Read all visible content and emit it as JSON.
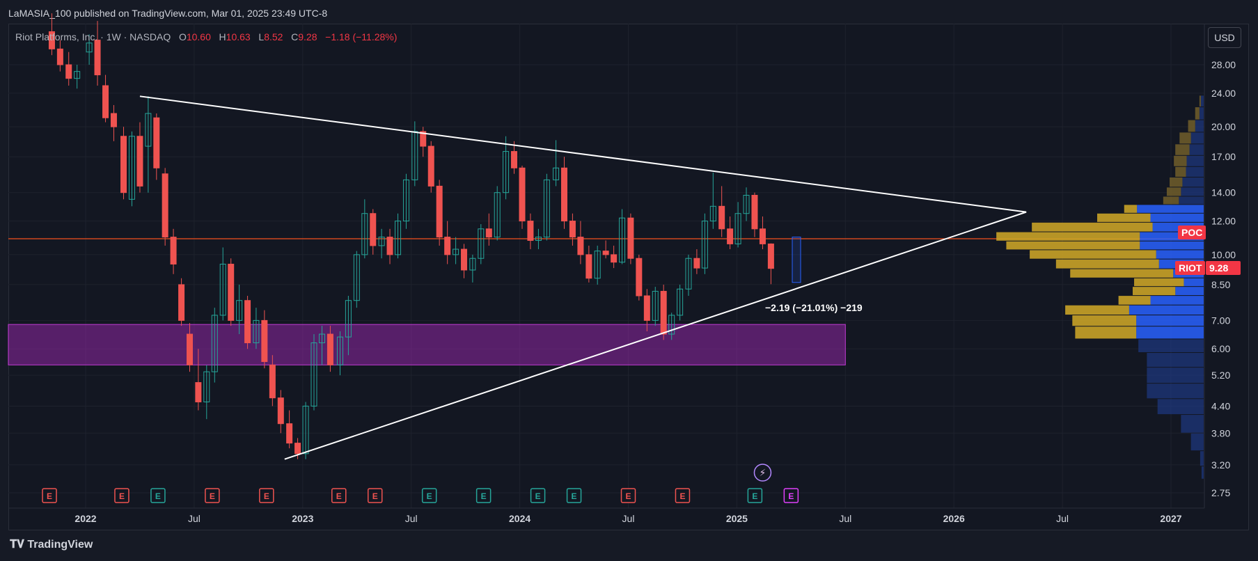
{
  "header": {
    "published": "LaMASIA_100 published on TradingView.com, Mar 01, 2025 23:49 UTC-8"
  },
  "symbol": {
    "title": "Riot Platforms, Inc. · 1W · NASDAQ",
    "o_label": "O",
    "o": "10.60",
    "h_label": "H",
    "h": "10.63",
    "l_label": "L",
    "l": "8.52",
    "c_label": "C",
    "c": "9.28",
    "change": "−1.18 (−11.28%)"
  },
  "currency": "USD",
  "badges": {
    "poc": "POC",
    "ticker": "RIOT",
    "price": "9.28"
  },
  "measure_label": "−2.19 (−21.01%) −219",
  "footer": {
    "logo_text": "TradingView"
  },
  "chart_data": {
    "type": "candlestick",
    "title": "Riot Platforms, Inc. · 1W · NASDAQ",
    "ylim": [
      2.6,
      36
    ],
    "y_scale": "log",
    "y_ticks": [
      "28.00",
      "24.00",
      "20.00",
      "17.00",
      "14.00",
      "12.00",
      "10.00",
      "8.50",
      "7.00",
      "6.00",
      "5.20",
      "4.40",
      "3.80",
      "3.20",
      "2.75"
    ],
    "x_ticks": [
      "2022",
      "Jul",
      "2023",
      "Jul",
      "2024",
      "Jul",
      "2025",
      "Jul",
      "2026",
      "Jul",
      "2027"
    ],
    "x_tick_dates": [
      "2022-01",
      "2022-07",
      "2023-01",
      "2023-07",
      "2024-01",
      "2024-07",
      "2025-01",
      "2025-07",
      "2026-01",
      "2026-07",
      "2027-01"
    ],
    "grid": true,
    "last_close": 9.28,
    "poc_level": 10.9,
    "purple_zone": {
      "from_date": "2021-12",
      "to_date": "2025-07",
      "low": 5.5,
      "high": 6.85
    },
    "trendlines": [
      {
        "label": "upper resistance",
        "from": [
          "2022-04",
          23.6
        ],
        "to": [
          "2026-05",
          12.6
        ]
      },
      {
        "label": "lower support",
        "from": [
          "2022-12",
          3.3
        ],
        "to": [
          "2026-05",
          12.6
        ]
      }
    ],
    "earnings_markers": [
      {
        "date": "2021-11",
        "type": "miss"
      },
      {
        "date": "2022-03",
        "type": "miss"
      },
      {
        "date": "2022-05",
        "type": "beat"
      },
      {
        "date": "2022-08",
        "type": "miss"
      },
      {
        "date": "2022-11",
        "type": "miss"
      },
      {
        "date": "2023-03",
        "type": "miss"
      },
      {
        "date": "2023-05",
        "type": "miss"
      },
      {
        "date": "2023-08",
        "type": "beat"
      },
      {
        "date": "2023-11",
        "type": "beat"
      },
      {
        "date": "2024-02",
        "type": "beat"
      },
      {
        "date": "2024-04",
        "type": "beat"
      },
      {
        "date": "2024-07",
        "type": "miss"
      },
      {
        "date": "2024-10",
        "type": "miss"
      },
      {
        "date": "2025-02",
        "type": "beat"
      },
      {
        "date": "2025-04",
        "type": "upcoming"
      }
    ],
    "volume_profile": [
      {
        "price": 23.0,
        "up": 0.2,
        "down": 0.4
      },
      {
        "price": 21.5,
        "up": 0.6,
        "down": 0.6
      },
      {
        "price": 20.0,
        "up": 1.0,
        "down": 1.2
      },
      {
        "price": 18.8,
        "up": 1.6,
        "down": 1.8
      },
      {
        "price": 17.6,
        "up": 2.0,
        "down": 2.0
      },
      {
        "price": 16.6,
        "up": 1.8,
        "down": 2.4
      },
      {
        "price": 15.6,
        "up": 1.5,
        "down": 2.5
      },
      {
        "price": 14.8,
        "up": 1.8,
        "down": 3.0
      },
      {
        "price": 14.0,
        "up": 2.0,
        "down": 3.2
      },
      {
        "price": 13.4,
        "up": 2.2,
        "down": 3.5
      },
      {
        "price": 12.8,
        "up": 1.8,
        "down": 9.4
      },
      {
        "price": 12.2,
        "up": 7.5,
        "down": 7.5
      },
      {
        "price": 11.6,
        "up": 17.0,
        "down": 7.2
      },
      {
        "price": 11.0,
        "up": 20.2,
        "down": 9.0
      },
      {
        "price": 10.5,
        "up": 18.8,
        "down": 9.0
      },
      {
        "price": 10.0,
        "up": 17.8,
        "down": 6.7
      },
      {
        "price": 9.5,
        "up": 14.5,
        "down": 6.3
      },
      {
        "price": 9.0,
        "up": 14.5,
        "down": 4.3
      },
      {
        "price": 8.6,
        "up": 7.0,
        "down": 2.8
      },
      {
        "price": 8.2,
        "up": 6.0,
        "down": 4.0
      },
      {
        "price": 7.8,
        "up": 4.5,
        "down": 7.5
      },
      {
        "price": 7.4,
        "up": 9.0,
        "down": 10.5
      },
      {
        "price": 7.0,
        "up": 9.0,
        "down": 9.5
      },
      {
        "price": 6.55,
        "up": 8.6,
        "down": 9.5
      },
      {
        "price": 6.1,
        "up": 0.0,
        "down": 9.2
      },
      {
        "price": 5.65,
        "up": 0.0,
        "down": 8.0
      },
      {
        "price": 5.2,
        "up": 0.0,
        "down": 8.0
      },
      {
        "price": 4.75,
        "up": 0.0,
        "down": 8.0
      },
      {
        "price": 4.4,
        "up": 0.0,
        "down": 6.5
      },
      {
        "price": 4.0,
        "up": 0.0,
        "down": 3.2
      },
      {
        "price": 3.6,
        "up": 0.0,
        "down": 1.8
      },
      {
        "price": 3.3,
        "up": 0.0,
        "down": 0.5
      },
      {
        "price": 3.05,
        "up": 0.0,
        "down": 0.3
      }
    ],
    "candles": [
      {
        "t": "2021-11-05",
        "o": 33.5,
        "h": 37.0,
        "l": 29.5,
        "c": 30.5
      },
      {
        "t": "2021-11-19",
        "o": 30.5,
        "h": 32.0,
        "l": 27.0,
        "c": 28.0
      },
      {
        "t": "2021-12-03",
        "o": 28.0,
        "h": 30.0,
        "l": 25.0,
        "c": 26.0
      },
      {
        "t": "2021-12-17",
        "o": 26.0,
        "h": 28.0,
        "l": 24.6,
        "c": 27.0
      },
      {
        "t": "2022-01-07",
        "o": 30.0,
        "h": 33.0,
        "l": 28.0,
        "c": 31.5
      },
      {
        "t": "2022-01-21",
        "o": 32.0,
        "h": 35.5,
        "l": 25.0,
        "c": 26.5
      },
      {
        "t": "2022-02-04",
        "o": 25.0,
        "h": 26.5,
        "l": 20.5,
        "c": 21.0
      },
      {
        "t": "2022-02-18",
        "o": 21.5,
        "h": 22.5,
        "l": 18.5,
        "c": 20.0
      },
      {
        "t": "2022-03-04",
        "o": 19.0,
        "h": 20.0,
        "l": 13.5,
        "c": 14.0
      },
      {
        "t": "2022-03-18",
        "o": 13.5,
        "h": 19.5,
        "l": 13.0,
        "c": 19.0
      },
      {
        "t": "2022-04-01",
        "o": 19.0,
        "h": 20.5,
        "l": 14.0,
        "c": 14.5
      },
      {
        "t": "2022-04-15",
        "o": 18.0,
        "h": 23.6,
        "l": 14.0,
        "c": 21.5
      },
      {
        "t": "2022-04-29",
        "o": 21.0,
        "h": 21.5,
        "l": 15.0,
        "c": 16.0
      },
      {
        "t": "2022-05-13",
        "o": 15.5,
        "h": 16.0,
        "l": 10.5,
        "c": 11.0
      },
      {
        "t": "2022-05-27",
        "o": 11.0,
        "h": 11.5,
        "l": 9.0,
        "c": 9.5
      },
      {
        "t": "2022-06-10",
        "o": 8.5,
        "h": 8.8,
        "l": 6.8,
        "c": 7.0
      },
      {
        "t": "2022-06-24",
        "o": 6.5,
        "h": 6.9,
        "l": 5.3,
        "c": 5.5
      },
      {
        "t": "2022-07-08",
        "o": 5.0,
        "h": 6.0,
        "l": 4.3,
        "c": 4.5
      },
      {
        "t": "2022-07-22",
        "o": 4.5,
        "h": 5.5,
        "l": 4.1,
        "c": 5.3
      },
      {
        "t": "2022-08-05",
        "o": 5.3,
        "h": 7.5,
        "l": 5.0,
        "c": 7.2
      },
      {
        "t": "2022-08-19",
        "o": 7.2,
        "h": 10.4,
        "l": 7.0,
        "c": 9.5
      },
      {
        "t": "2022-09-02",
        "o": 9.5,
        "h": 9.8,
        "l": 6.8,
        "c": 7.0
      },
      {
        "t": "2022-09-16",
        "o": 7.0,
        "h": 8.5,
        "l": 6.5,
        "c": 7.8
      },
      {
        "t": "2022-09-30",
        "o": 7.8,
        "h": 8.0,
        "l": 6.0,
        "c": 6.2
      },
      {
        "t": "2022-10-14",
        "o": 6.2,
        "h": 7.5,
        "l": 6.0,
        "c": 7.0
      },
      {
        "t": "2022-10-28",
        "o": 7.0,
        "h": 7.4,
        "l": 5.4,
        "c": 5.6
      },
      {
        "t": "2022-11-11",
        "o": 5.5,
        "h": 5.8,
        "l": 4.4,
        "c": 4.6
      },
      {
        "t": "2022-11-25",
        "o": 4.6,
        "h": 4.8,
        "l": 3.8,
        "c": 4.0
      },
      {
        "t": "2022-12-09",
        "o": 4.0,
        "h": 4.3,
        "l": 3.5,
        "c": 3.6
      },
      {
        "t": "2022-12-23",
        "o": 3.6,
        "h": 3.7,
        "l": 3.3,
        "c": 3.4
      },
      {
        "t": "2023-01-06",
        "o": 3.4,
        "h": 4.5,
        "l": 3.3,
        "c": 4.4
      },
      {
        "t": "2023-01-20",
        "o": 4.4,
        "h": 6.5,
        "l": 4.3,
        "c": 6.2
      },
      {
        "t": "2023-02-03",
        "o": 6.2,
        "h": 6.8,
        "l": 5.5,
        "c": 6.5
      },
      {
        "t": "2023-02-17",
        "o": 6.5,
        "h": 6.8,
        "l": 5.3,
        "c": 5.5
      },
      {
        "t": "2023-03-03",
        "o": 5.5,
        "h": 6.6,
        "l": 5.2,
        "c": 6.4
      },
      {
        "t": "2023-03-17",
        "o": 6.4,
        "h": 8.0,
        "l": 5.8,
        "c": 7.8
      },
      {
        "t": "2023-03-31",
        "o": 7.8,
        "h": 10.2,
        "l": 7.5,
        "c": 10.0
      },
      {
        "t": "2023-04-14",
        "o": 10.0,
        "h": 13.5,
        "l": 9.8,
        "c": 12.5
      },
      {
        "t": "2023-04-28",
        "o": 12.5,
        "h": 12.8,
        "l": 10.0,
        "c": 10.5
      },
      {
        "t": "2023-05-12",
        "o": 10.5,
        "h": 11.5,
        "l": 9.8,
        "c": 11.0
      },
      {
        "t": "2023-05-26",
        "o": 11.0,
        "h": 11.5,
        "l": 9.5,
        "c": 10.0
      },
      {
        "t": "2023-06-09",
        "o": 10.0,
        "h": 12.5,
        "l": 9.8,
        "c": 12.0
      },
      {
        "t": "2023-06-23",
        "o": 12.0,
        "h": 15.5,
        "l": 11.5,
        "c": 15.0
      },
      {
        "t": "2023-07-07",
        "o": 15.0,
        "h": 20.6,
        "l": 14.5,
        "c": 19.5
      },
      {
        "t": "2023-07-21",
        "o": 19.5,
        "h": 20.0,
        "l": 17.0,
        "c": 18.0
      },
      {
        "t": "2023-08-04",
        "o": 18.0,
        "h": 18.5,
        "l": 14.0,
        "c": 14.5
      },
      {
        "t": "2023-08-18",
        "o": 14.5,
        "h": 15.0,
        "l": 10.5,
        "c": 11.0
      },
      {
        "t": "2023-09-01",
        "o": 11.0,
        "h": 12.0,
        "l": 9.5,
        "c": 10.0
      },
      {
        "t": "2023-09-15",
        "o": 10.0,
        "h": 11.0,
        "l": 9.5,
        "c": 10.3
      },
      {
        "t": "2023-09-29",
        "o": 10.3,
        "h": 10.6,
        "l": 8.8,
        "c": 9.2
      },
      {
        "t": "2023-10-13",
        "o": 9.2,
        "h": 10.0,
        "l": 8.6,
        "c": 9.8
      },
      {
        "t": "2023-10-27",
        "o": 9.8,
        "h": 11.8,
        "l": 9.5,
        "c": 11.5
      },
      {
        "t": "2023-11-10",
        "o": 11.5,
        "h": 12.5,
        "l": 10.5,
        "c": 11.0
      },
      {
        "t": "2023-11-24",
        "o": 11.0,
        "h": 14.5,
        "l": 10.8,
        "c": 14.0
      },
      {
        "t": "2023-12-08",
        "o": 14.0,
        "h": 19.0,
        "l": 13.5,
        "c": 17.5
      },
      {
        "t": "2023-12-22",
        "o": 17.5,
        "h": 18.5,
        "l": 15.5,
        "c": 16.0
      },
      {
        "t": "2024-01-05",
        "o": 16.0,
        "h": 16.2,
        "l": 11.5,
        "c": 12.0
      },
      {
        "t": "2024-01-19",
        "o": 12.0,
        "h": 12.5,
        "l": 10.3,
        "c": 10.8
      },
      {
        "t": "2024-02-02",
        "o": 10.8,
        "h": 11.5,
        "l": 10.3,
        "c": 11.0
      },
      {
        "t": "2024-02-16",
        "o": 11.0,
        "h": 15.5,
        "l": 10.8,
        "c": 15.0
      },
      {
        "t": "2024-03-01",
        "o": 15.0,
        "h": 18.6,
        "l": 14.5,
        "c": 16.0
      },
      {
        "t": "2024-03-15",
        "o": 16.0,
        "h": 17.0,
        "l": 11.5,
        "c": 12.0
      },
      {
        "t": "2024-03-29",
        "o": 12.0,
        "h": 12.5,
        "l": 10.5,
        "c": 11.0
      },
      {
        "t": "2024-04-12",
        "o": 11.0,
        "h": 12.0,
        "l": 9.5,
        "c": 10.0
      },
      {
        "t": "2024-04-26",
        "o": 10.0,
        "h": 10.5,
        "l": 8.6,
        "c": 8.8
      },
      {
        "t": "2024-05-10",
        "o": 8.8,
        "h": 10.5,
        "l": 8.5,
        "c": 10.2
      },
      {
        "t": "2024-05-24",
        "o": 10.2,
        "h": 10.8,
        "l": 9.8,
        "c": 10.0
      },
      {
        "t": "2024-06-07",
        "o": 10.0,
        "h": 10.5,
        "l": 9.3,
        "c": 9.6
      },
      {
        "t": "2024-06-21",
        "o": 9.6,
        "h": 12.8,
        "l": 9.5,
        "c": 12.2
      },
      {
        "t": "2024-07-05",
        "o": 12.2,
        "h": 12.5,
        "l": 9.5,
        "c": 9.8
      },
      {
        "t": "2024-07-19",
        "o": 9.8,
        "h": 10.0,
        "l": 7.8,
        "c": 8.0
      },
      {
        "t": "2024-08-02",
        "o": 8.0,
        "h": 8.3,
        "l": 6.6,
        "c": 7.0
      },
      {
        "t": "2024-08-16",
        "o": 7.0,
        "h": 8.4,
        "l": 6.8,
        "c": 8.2
      },
      {
        "t": "2024-08-30",
        "o": 8.2,
        "h": 8.5,
        "l": 6.3,
        "c": 6.5
      },
      {
        "t": "2024-09-13",
        "o": 6.5,
        "h": 7.3,
        "l": 6.3,
        "c": 7.2
      },
      {
        "t": "2024-09-27",
        "o": 7.2,
        "h": 8.5,
        "l": 7.0,
        "c": 8.3
      },
      {
        "t": "2024-10-11",
        "o": 8.3,
        "h": 10.0,
        "l": 8.0,
        "c": 9.8
      },
      {
        "t": "2024-10-25",
        "o": 9.8,
        "h": 10.3,
        "l": 9.0,
        "c": 9.3
      },
      {
        "t": "2024-11-08",
        "o": 9.3,
        "h": 12.5,
        "l": 9.0,
        "c": 12.0
      },
      {
        "t": "2024-11-22",
        "o": 12.0,
        "h": 15.6,
        "l": 11.5,
        "c": 13.0
      },
      {
        "t": "2024-12-06",
        "o": 13.0,
        "h": 14.5,
        "l": 11.0,
        "c": 11.5
      },
      {
        "t": "2024-12-20",
        "o": 11.5,
        "h": 12.3,
        "l": 10.3,
        "c": 10.6
      },
      {
        "t": "2025-01-03",
        "o": 10.6,
        "h": 13.3,
        "l": 10.4,
        "c": 12.5
      },
      {
        "t": "2025-01-17",
        "o": 12.5,
        "h": 14.4,
        "l": 12.0,
        "c": 13.8
      },
      {
        "t": "2025-01-31",
        "o": 13.8,
        "h": 14.0,
        "l": 11.0,
        "c": 11.5
      },
      {
        "t": "2025-02-14",
        "o": 11.5,
        "h": 12.3,
        "l": 10.3,
        "c": 10.6
      },
      {
        "t": "2025-02-28",
        "o": 10.6,
        "h": 10.63,
        "l": 8.52,
        "c": 9.28
      }
    ]
  }
}
